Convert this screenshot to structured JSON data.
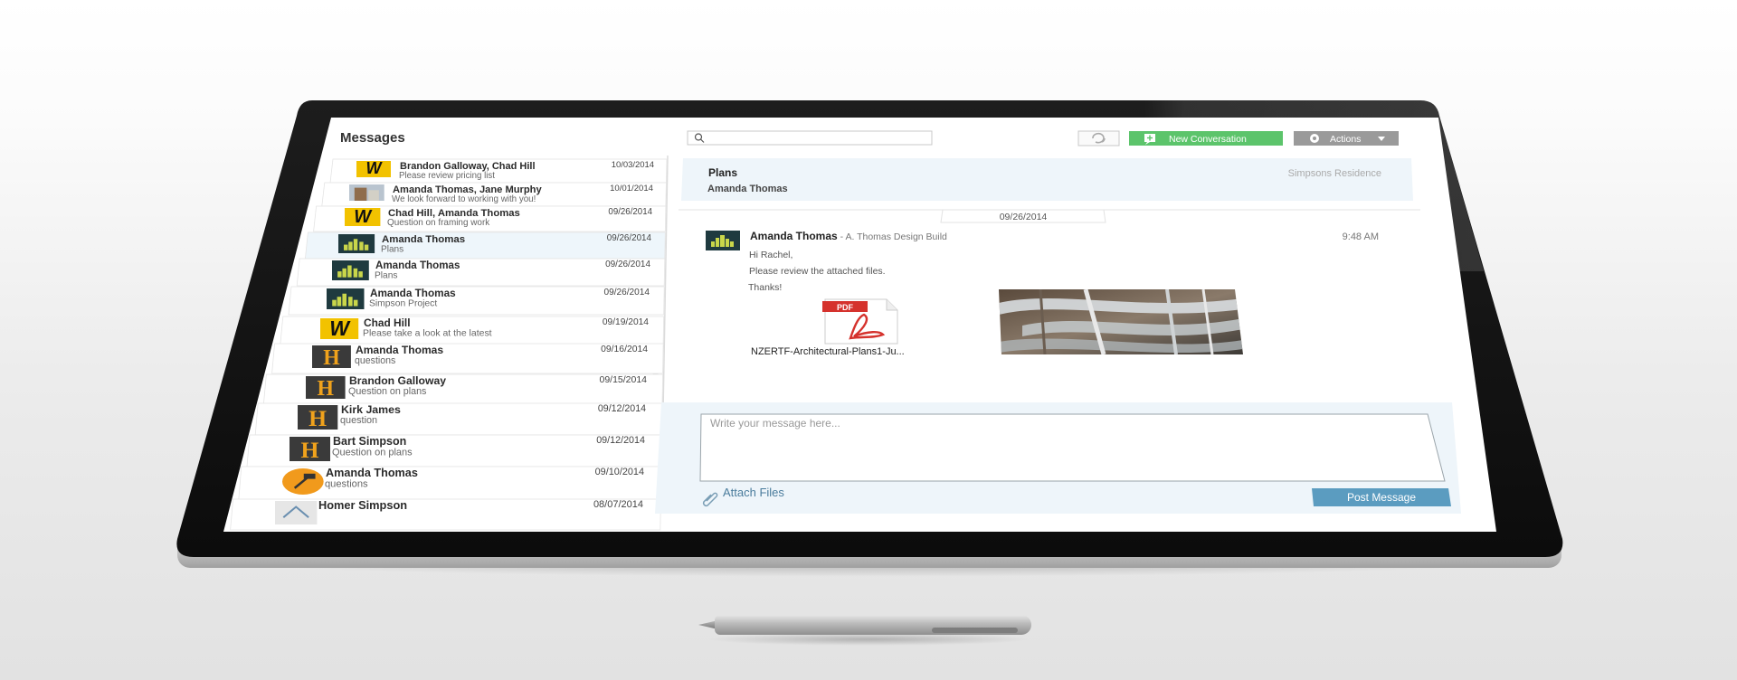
{
  "app": {
    "title": "Messages"
  },
  "search": {
    "placeholder": ""
  },
  "toolbar": {
    "new_conversation_label": "New Conversation",
    "actions_label": "Actions"
  },
  "colors": {
    "green": "#5cc46b",
    "gray_button": "#9a9a9a",
    "post_button": "#5b9cc0",
    "selected_row": "#eef6fb",
    "compose_bg": "#eef5fa"
  },
  "conversations": [
    {
      "name": "Brandon Galloway, Chad Hill",
      "preview": "Please review pricing list",
      "date": "10/03/2014",
      "icon": "w-logo-icon"
    },
    {
      "name": "Amanda Thomas, Jane Murphy",
      "preview": "We look forward to working with you!",
      "date": "10/01/2014",
      "icon": "building-photo-icon"
    },
    {
      "name": "Chad Hill, Amanda Thomas",
      "preview": "Question on framing work",
      "date": "09/26/2014",
      "icon": "w-logo-icon"
    },
    {
      "name": "Amanda Thomas",
      "preview": "Plans",
      "date": "09/26/2014",
      "icon": "skyline-logo-icon"
    },
    {
      "name": "Amanda Thomas",
      "preview": "Plans",
      "date": "09/26/2014",
      "icon": "skyline-logo-icon"
    },
    {
      "name": "Amanda Thomas",
      "preview": "Simpson Project",
      "date": "09/26/2014",
      "icon": "skyline-logo-icon"
    },
    {
      "name": "Chad Hill",
      "preview": "Please take a look at the latest",
      "date": "09/19/2014",
      "icon": "w-logo-icon"
    },
    {
      "name": "Amanda Thomas",
      "preview": "questions",
      "date": "09/16/2014",
      "icon": "h-logo-icon"
    },
    {
      "name": "Brandon Galloway",
      "preview": "Question on plans",
      "date": "09/15/2014",
      "icon": "h-logo-icon"
    },
    {
      "name": "Kirk James",
      "preview": "question",
      "date": "09/12/2014",
      "icon": "h-logo-icon"
    },
    {
      "name": "Bart Simpson",
      "preview": "Question on plans",
      "date": "09/12/2014",
      "icon": "h-logo-icon"
    },
    {
      "name": "Amanda Thomas",
      "preview": "questions",
      "date": "09/10/2014",
      "icon": "hammer-logo-icon"
    },
    {
      "name": "Homer Simpson",
      "preview": "",
      "date": "08/07/2014",
      "icon": "house-logo-icon"
    }
  ],
  "thread": {
    "subject": "Plans",
    "participant": "Amanda Thomas",
    "project": "Simpsons Residence",
    "date_tab": "09/26/2014",
    "message": {
      "sender": "Amanda Thomas",
      "company": " - A. Thomas Design Build",
      "time": "9:48 AM",
      "lines": [
        "Hi Rachel,",
        "Please review the attached files.",
        "Thanks!"
      ],
      "attachment_name": "NZERTF-Architectural-Plans1-Ju...",
      "pdf_label": "PDF"
    }
  },
  "compose": {
    "placeholder": "Write your message here...",
    "attach_label": "Attach Files",
    "post_label": "Post Message"
  }
}
